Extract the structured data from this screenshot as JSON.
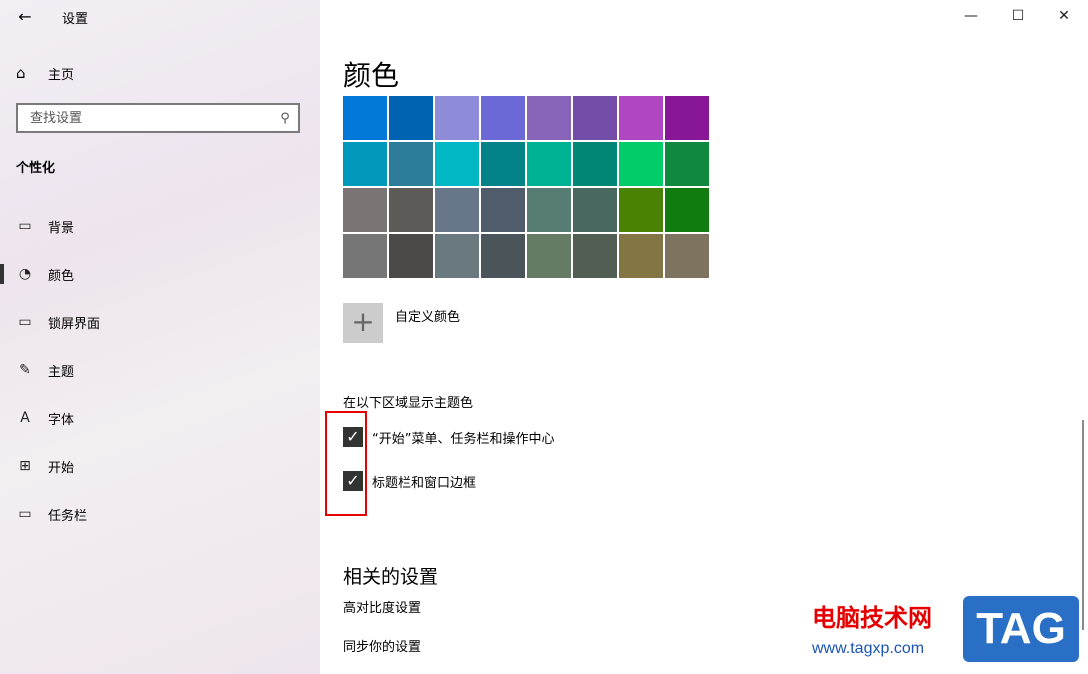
{
  "window": {
    "title": "设置",
    "back_icon": "back-arrow-icon",
    "controls": {
      "minimize": "—",
      "maximize": "☐",
      "close": "✕"
    }
  },
  "sidebar": {
    "home": {
      "icon": "home-icon",
      "label": "主页"
    },
    "search": {
      "placeholder": "查找设置",
      "icon": "search-icon"
    },
    "section_title": "个性化",
    "items": [
      {
        "icon": "picture-icon",
        "glyph": "▭",
        "label": "背景",
        "active": false
      },
      {
        "icon": "palette-icon",
        "glyph": "◔",
        "label": "颜色",
        "active": true
      },
      {
        "icon": "lock-screen-icon",
        "glyph": "▭",
        "label": "锁屏界面",
        "active": false
      },
      {
        "icon": "theme-icon",
        "glyph": "✎",
        "label": "主题",
        "active": false
      },
      {
        "icon": "font-icon",
        "glyph": "A",
        "label": "字体",
        "active": false
      },
      {
        "icon": "start-icon",
        "glyph": "⊞",
        "label": "开始",
        "active": false
      },
      {
        "icon": "taskbar-icon",
        "glyph": "▭",
        "label": "任务栏",
        "active": false
      }
    ]
  },
  "main": {
    "title": "颜色",
    "swatches": [
      "#0078d7",
      "#0063b1",
      "#8e8cd8",
      "#6b69d6",
      "#8764b8",
      "#744da9",
      "#b146c2",
      "#881798",
      "#0099bc",
      "#2d7d9a",
      "#00b7c3",
      "#038387",
      "#00b294",
      "#018574",
      "#00cc6a",
      "#10893e",
      "#7a7574",
      "#5d5a58",
      "#68768a",
      "#515c6b",
      "#567c73",
      "#486860",
      "#498205",
      "#107c10",
      "#767676",
      "#4c4a48",
      "#69797e",
      "#4a5459",
      "#647c64",
      "#525e54",
      "#847545",
      "#7e735f"
    ],
    "custom_color": {
      "icon": "plus-icon",
      "label": "自定义颜色"
    },
    "accent_heading": "在以下区域显示主题色",
    "checkboxes": [
      {
        "label": "“开始”菜单、任务栏和操作中心",
        "checked": true
      },
      {
        "label": "标题栏和窗口边框",
        "checked": true
      }
    ],
    "related_heading": "相关的设置",
    "related_links": [
      "高对比度设置",
      "同步你的设置"
    ]
  },
  "watermark": {
    "site_name": "电脑技术网",
    "url": "www.tagxp.com",
    "logo_text": "TAG"
  },
  "colors": {
    "annotation_box": "#e60000",
    "checkbox_fill": "#333333"
  }
}
